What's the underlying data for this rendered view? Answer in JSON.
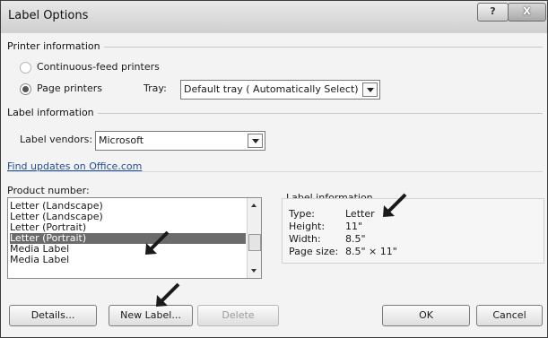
{
  "window": {
    "title": "Label Options",
    "help_glyph": "?",
    "close_glyph": "X"
  },
  "printer_info": {
    "legend": "Printer information",
    "continuous_label": "Continuous-feed printers",
    "page_label": "Page printers",
    "tray_label": "Tray:",
    "tray_value": "Default tray ( Automatically Select)",
    "selected": "page"
  },
  "label_info_section": {
    "legend": "Label information",
    "vendors_label": "Label vendors:",
    "vendors_value": "Microsoft"
  },
  "find_updates_link": "Find updates on Office.com",
  "product_number": {
    "label": "Product number:",
    "items": [
      "Letter (Landscape)",
      "Letter (Landscape)",
      "Letter (Portrait)",
      "Letter (Portrait)",
      "Media Label",
      "Media Label"
    ],
    "selected_index": 3
  },
  "label_information_panel": {
    "legend": "Label information",
    "rows": [
      {
        "key": "Type:",
        "value": "Letter"
      },
      {
        "key": "Height:",
        "value": "11\""
      },
      {
        "key": "Width:",
        "value": "8.5\""
      },
      {
        "key": "Page size:",
        "value": "8.5\" × 11\""
      }
    ]
  },
  "buttons": {
    "details": "Details...",
    "new_label": "New Label...",
    "delete": "Delete",
    "ok": "OK",
    "cancel": "Cancel"
  },
  "colors": {
    "annotation_arrow": "#1a1a1a",
    "selected_row": "#6b6b6b"
  },
  "icons": [
    "arrow-annotation-icon"
  ]
}
